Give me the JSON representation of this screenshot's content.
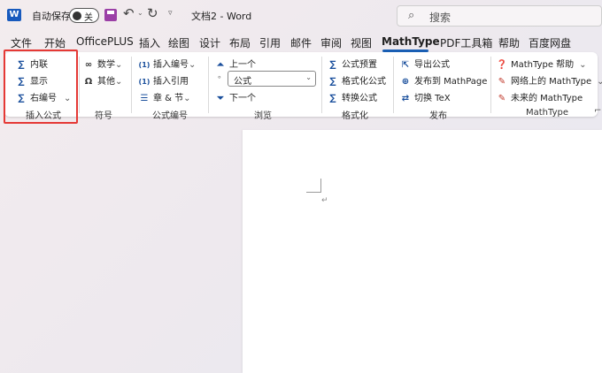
{
  "titlebar": {
    "app_icon": "W",
    "autosave_label": "自动保存",
    "autosave_state": "关",
    "doc_title": "文档2  -  Word",
    "search_placeholder": "搜索"
  },
  "menu": {
    "tabs": [
      "文件",
      "开始",
      "OfficePLUS",
      "插入",
      "绘图",
      "设计",
      "布局",
      "引用",
      "邮件",
      "审阅",
      "视图",
      "MathType",
      "PDF工具箱",
      "帮助",
      "百度网盘"
    ],
    "active": "MathType"
  },
  "ribbon": {
    "insert_equation": {
      "inline": "内联",
      "display": "显示",
      "right_numbered": "右编号",
      "label": "插入公式"
    },
    "symbols": {
      "math": "数学",
      "other": "其他",
      "label": "符号"
    },
    "equation_numbers": {
      "insert_number": "插入编号",
      "insert_reference": "插入引用",
      "chapter_section": "章 & 节",
      "label": "公式编号"
    },
    "browse": {
      "previous": "上一个",
      "combo_value": "公式",
      "next": "下一个",
      "label": "浏览"
    },
    "format": {
      "presets": "公式预置",
      "format_equations": "格式化公式",
      "convert": "转换公式",
      "label": "格式化"
    },
    "publish": {
      "export": "导出公式",
      "publish_mathpage": "发布到 MathPage",
      "toggle_tex": "切换 TeX",
      "label": "发布"
    },
    "mathtype": {
      "help": "MathType 帮助",
      "online": "网络上的 MathType",
      "future": "未来的 MathType",
      "label": "MathType"
    }
  },
  "colors": {
    "accent": "#1a5fb4",
    "highlight_box": "#e53935",
    "word_blue": "#185abd"
  }
}
